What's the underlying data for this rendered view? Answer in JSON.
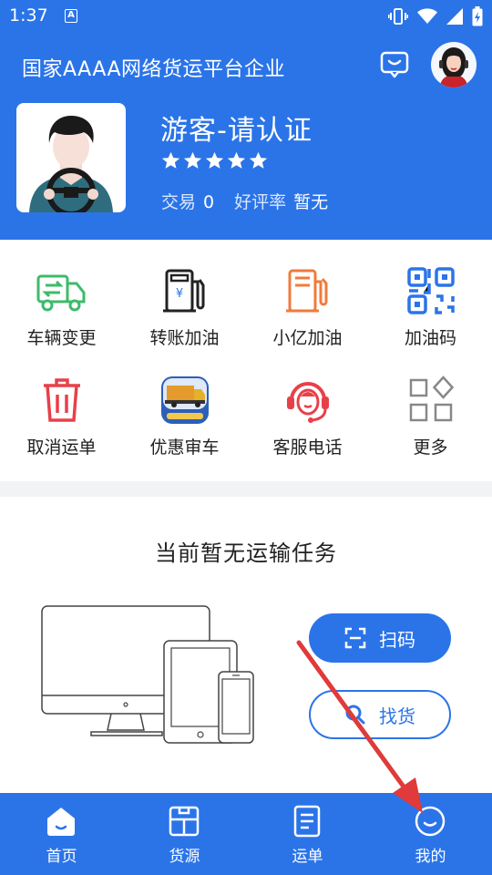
{
  "status_bar": {
    "time": "1:37",
    "icons": [
      "a-notification-icon",
      "vibrate-icon",
      "wifi-icon",
      "signal-icon",
      "battery-charging-icon"
    ]
  },
  "header": {
    "app_title": "国家AAAA网络货运平台企业",
    "user_name": "游客-请认证",
    "rating_stars": 5,
    "stats": {
      "trade_label": "交易",
      "trade_value": "0",
      "rating_label": "好评率",
      "rating_value": "暂无"
    }
  },
  "grid": {
    "items": [
      {
        "label": "车辆变更",
        "icon": "truck-swap-icon"
      },
      {
        "label": "转账加油",
        "icon": "fuel-pump-yuan-icon"
      },
      {
        "label": "小亿加油",
        "icon": "fuel-pump-icon"
      },
      {
        "label": "加油码",
        "icon": "qr-code-icon"
      },
      {
        "label": "取消运单",
        "icon": "trash-icon"
      },
      {
        "label": "优惠审车",
        "icon": "truck-inspection-icon"
      },
      {
        "label": "客服电话",
        "icon": "headset-agent-icon"
      },
      {
        "label": "更多",
        "icon": "more-apps-icon"
      }
    ]
  },
  "task": {
    "title": "当前暂无运输任务",
    "scan_label": "扫码",
    "find_label": "找货"
  },
  "nav": {
    "items": [
      {
        "label": "首页",
        "icon": "home-icon"
      },
      {
        "label": "货源",
        "icon": "cargo-source-icon"
      },
      {
        "label": "运单",
        "icon": "waybill-icon"
      },
      {
        "label": "我的",
        "icon": "profile-smile-icon"
      }
    ]
  },
  "colors": {
    "primary": "#2b74e8",
    "green": "#3dbb6a",
    "orange": "#f07b3a",
    "red": "#e8404a",
    "annotation_arrow": "#e03a3a"
  }
}
